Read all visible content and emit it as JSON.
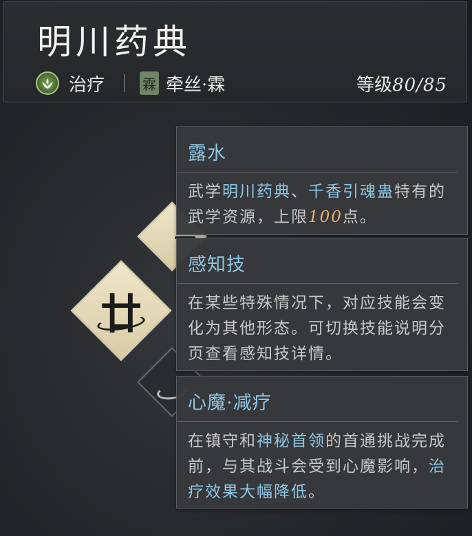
{
  "header": {
    "title": "明川药典",
    "role_label": "治疗",
    "role_icon": "healing-leaf-icon",
    "sect_icon_glyph": "霖",
    "sect_label": "牵丝·霖",
    "level_prefix": "等级",
    "level_value": "80/85"
  },
  "skills": {
    "main_glyph": "廿"
  },
  "tooltips": [
    {
      "title": "露水",
      "body_parts": [
        {
          "t": "武学",
          "c": ""
        },
        {
          "t": "明川药典",
          "c": "hl"
        },
        {
          "t": "、",
          "c": ""
        },
        {
          "t": "千香引魂蛊",
          "c": "hl"
        },
        {
          "t": "特有的武学资源，上限",
          "c": ""
        },
        {
          "t": "100",
          "c": "num"
        },
        {
          "t": "点。",
          "c": ""
        }
      ]
    },
    {
      "title": "感知技",
      "body_parts": [
        {
          "t": "在某些特殊情况下，对应技能会变化为其他形态。可切换技能说明分页查看感知技详情。",
          "c": ""
        }
      ]
    },
    {
      "title": "心魔·减疗",
      "body_parts": [
        {
          "t": "在镇守和",
          "c": ""
        },
        {
          "t": "神秘首领",
          "c": "hl"
        },
        {
          "t": "的首通挑战完成前，与其战斗会受到心魔影响，",
          "c": ""
        },
        {
          "t": "治疗效果大幅降低",
          "c": "hl"
        },
        {
          "t": "。",
          "c": ""
        }
      ]
    }
  ]
}
